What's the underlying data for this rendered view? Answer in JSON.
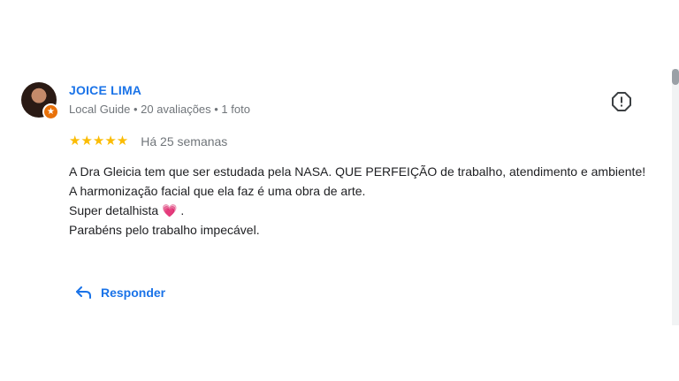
{
  "review": {
    "author": {
      "name": "JOICE LIMA",
      "meta": "Local Guide • 20 avaliações • 1 foto",
      "avatar_icon": "profile-photo",
      "badge_icon": "local-guide-star-icon"
    },
    "rating": {
      "stars": 5,
      "stars_text": "★★★★★",
      "date": "Há 25 semanas"
    },
    "text": {
      "line1": "A Dra Gleicia tem que ser estudada pela NASA. QUE PERFEIÇÃO de trabalho, atendimento e ambiente!",
      "line2": "A harmonização facial que ela faz é uma obra de arte.",
      "line3_prefix": "Super detalhista ",
      "line3_emoji": "💗",
      "line3_suffix": " .",
      "line4": "Parabéns pelo trabalho impecável."
    },
    "actions": {
      "report_icon": "report-icon",
      "reply_label": "Responder",
      "reply_icon": "reply-arrow-icon"
    }
  },
  "colors": {
    "accent": "#1a73e8",
    "star": "#fbbc04",
    "badge": "#e8710a",
    "muted": "#70757a"
  }
}
